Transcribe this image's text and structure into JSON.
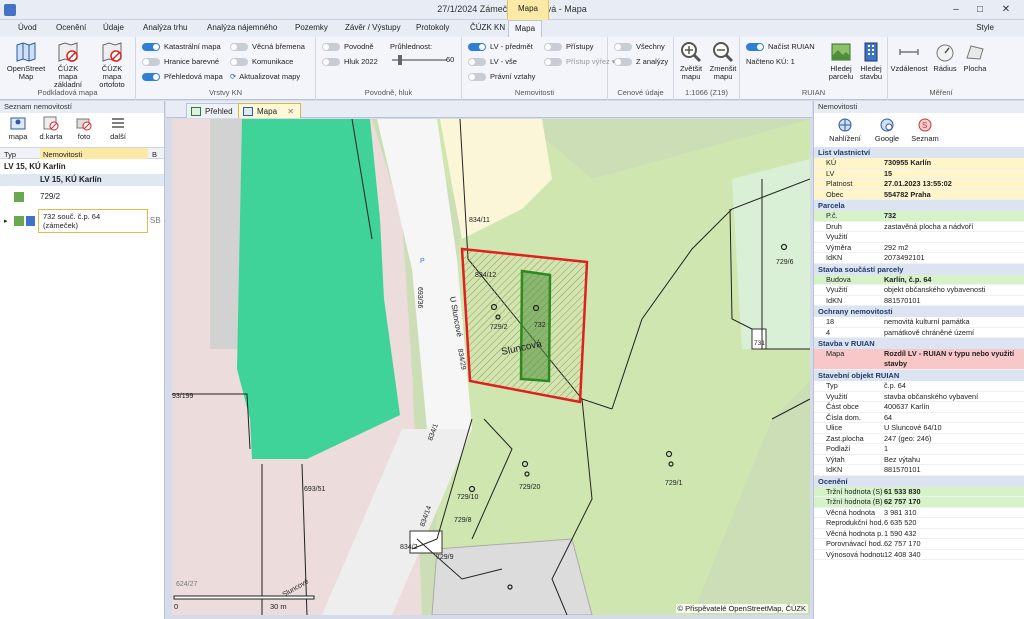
{
  "window": {
    "title": "27/1/2024  Zámeček Sluncová - Mapa",
    "context_group": "Mapa",
    "minimize": "–",
    "maximize": "□",
    "close": "✕"
  },
  "tabs": [
    "Úvod",
    "Ocenění",
    "Údaje",
    "Analýza trhu",
    "Analýza nájemného",
    "Pozemky",
    "Závěr / Výstupy",
    "Protokoly",
    "ČÚZK KN",
    "Mapa"
  ],
  "style_label": "Style",
  "ribbon": {
    "podkladova": {
      "label": "Podkladová mapa",
      "buttons": [
        "OpenStreet Map",
        "ČÚZK mapa základní",
        "ČÚZK mapa ortofoto"
      ]
    },
    "vrstvy": {
      "label": "Vrstvy KN",
      "toggles": [
        {
          "text": "Katastrální mapa",
          "on": true
        },
        {
          "text": "Hranice barevné",
          "on": false
        },
        {
          "text": "Přehledová mapa",
          "on": true
        },
        {
          "text": "Věcná břemena",
          "on": false
        },
        {
          "text": "Komunikace",
          "on": false
        },
        {
          "text": "Aktualizovat mapy",
          "on": false
        }
      ]
    },
    "povodne": {
      "label": "Povodně, hluk",
      "toggles": [
        {
          "text": "Povodně",
          "on": false
        },
        {
          "text": "Hluk 2022",
          "on": false
        }
      ],
      "pruhlednost": "Průhlednost:",
      "slider_value": "60",
      "slider_fraction": 0.1
    },
    "nemovitosti": {
      "label": "Nemovitosti",
      "toggles": [
        {
          "text": "LV - předmět",
          "on": true
        },
        {
          "text": "LV - vše",
          "on": false
        },
        {
          "text": "Právní vztahy",
          "on": false
        },
        {
          "text": "Přístupy",
          "on": false
        },
        {
          "text": "Přístup výřez",
          "on": false
        }
      ]
    },
    "cenove": {
      "label": "Cenové údaje",
      "toggles": [
        {
          "text": "Všechny",
          "on": false
        },
        {
          "text": "Z analýzy",
          "on": false
        }
      ]
    },
    "zoom": {
      "label": "1:1066 (Z19)",
      "buttons": [
        "Zvětšit mapu",
        "Zmenšit mapu"
      ]
    },
    "ruian": {
      "label": "RUIAN",
      "toggle": "Načíst RUIAN",
      "count": "Načteno KÚ:  1",
      "buttons": [
        "Hledej parcelu",
        "Hledej stavbu"
      ]
    },
    "mereni": {
      "label": "Měření",
      "buttons": [
        "Vzdálenost",
        "Rádius",
        "Plocha"
      ]
    }
  },
  "left": {
    "title": "Seznam nemovitostí",
    "tools": [
      "mapa",
      "d.karta",
      "foto",
      "další"
    ],
    "header": {
      "typ": "Typ",
      "nem": "Nemovitosti",
      "b": "B"
    },
    "group": "LV 15, KÚ Karlín",
    "row1": "LV 15, KÚ Karlín",
    "row2": "729/2",
    "row3a": "732  souč. č.p. 64",
    "row3b": "(zámeček)",
    "row3flag": "SB"
  },
  "doc_tabs": [
    "Přehled",
    "Mapa"
  ],
  "map": {
    "labels": [
      "834/11",
      "834/12",
      "729/2",
      "732",
      "Sluncová",
      "U Sluncové",
      "693/36",
      "693/51",
      "834/1",
      "729/10",
      "729/20",
      "729/1",
      "729/6",
      "731",
      "729/8",
      "729/9",
      "834/2",
      "834/14",
      "93/199",
      "624/27",
      "P",
      "Sluncové",
      "834/29"
    ],
    "scale_start": "0",
    "scale_end": "30 m",
    "attribution": "© Přispěvatelé OpenStreetMap, ČÚZK"
  },
  "right": {
    "title": "Nemovitosti",
    "tools": [
      "Nahlížení",
      "Google",
      "Seznam"
    ],
    "sections": [
      {
        "title": "List vlastnictví",
        "rows": [
          [
            "KÚ",
            "730955  Karlín",
            "y"
          ],
          [
            "LV",
            "15",
            "y"
          ],
          [
            "Platnost",
            "27.01.2023 13:55:02",
            "y"
          ],
          [
            "Obec",
            "554782  Praha",
            "y"
          ]
        ]
      },
      {
        "title": "Parcela",
        "rows": [
          [
            "P.č.",
            "732",
            "g"
          ],
          [
            "Druh",
            "zastavěná plocha a nádvoří",
            ""
          ],
          [
            "Využití",
            "",
            ""
          ],
          [
            "Výměra",
            "292  m2",
            ""
          ],
          [
            "IdKN",
            "2073492101",
            ""
          ]
        ]
      },
      {
        "title": "Stavba součástí parcely",
        "rows": [
          [
            "Budova",
            "Karlín, č.p. 64",
            "g"
          ],
          [
            "Využití",
            "objekt občanského vybavenosti",
            ""
          ],
          [
            "IdKN",
            "881570101",
            ""
          ]
        ]
      },
      {
        "title": "Ochrany nemovitosti",
        "rows": [
          [
            "18",
            "nemovitá kulturní památka",
            ""
          ],
          [
            "4",
            "památkově chráněné území",
            ""
          ]
        ]
      },
      {
        "title": "Stavba v RUIAN",
        "rows": [
          [
            "Mapa",
            "Rozdíl LV - RUIAN v typu nebo využití stavby",
            "r"
          ]
        ]
      },
      {
        "title": "Stavební objekt RUIAN",
        "rows": [
          [
            "Typ",
            "č.p. 64",
            ""
          ],
          [
            "Využití",
            "stavba občanského vybavení",
            ""
          ],
          [
            "Část obce",
            "400637  Karlín",
            ""
          ],
          [
            "Čísla dom.",
            "64",
            ""
          ],
          [
            "Ulice",
            "U Sluncové 64/10",
            ""
          ],
          [
            "Zast.plocha",
            "247  (geo: 246)",
            ""
          ],
          [
            "Podlaží",
            "1",
            ""
          ],
          [
            "Výtah",
            "Bez výtahu",
            ""
          ],
          [
            "IdKN",
            "881570101",
            ""
          ]
        ]
      },
      {
        "title": "Ocenění",
        "rows": [
          [
            "Tržní hodnota (S)",
            "61 533 830",
            "g"
          ],
          [
            "Tržní hodnota (B)",
            "62 757 170",
            "g"
          ],
          [
            "Věcná hodnota",
            "3 981 310",
            ""
          ],
          [
            "Reprodukční hod...",
            "6 635 520",
            ""
          ],
          [
            "Věcná hodnota p...",
            "1 590 432",
            ""
          ],
          [
            "Porovnávací hod...",
            "62 757 170",
            ""
          ],
          [
            "Výnosová hodnota",
            "12 408 340",
            ""
          ]
        ]
      }
    ]
  }
}
